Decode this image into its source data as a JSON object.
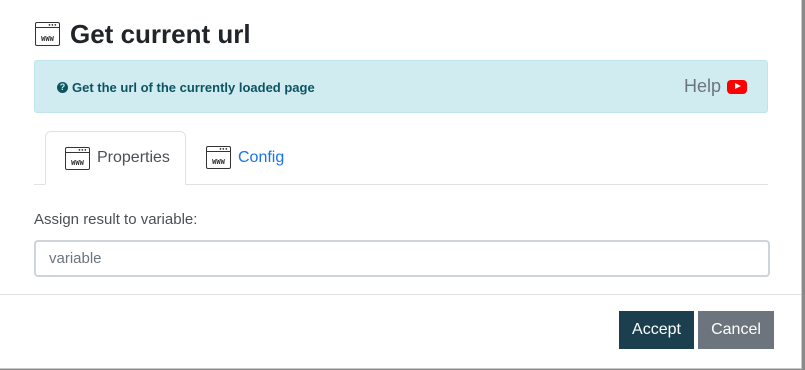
{
  "dialog": {
    "title": "Get current url",
    "title_icon": "www-icon"
  },
  "info": {
    "icon": "question-circle-icon",
    "text": "Get the url of the currently loaded page",
    "help_label": "Help",
    "help_icon": "youtube-icon"
  },
  "tabs": [
    {
      "label": "Properties",
      "icon": "www-icon",
      "active": true
    },
    {
      "label": "Config",
      "icon": "www-icon",
      "active": false
    }
  ],
  "form": {
    "variable_label": "Assign result to variable:",
    "variable_placeholder": "variable",
    "variable_value": ""
  },
  "footer": {
    "accept_label": "Accept",
    "cancel_label": "Cancel"
  },
  "icon_text": "WWW",
  "colors": {
    "accept": "#1c3f50",
    "cancel": "#6c757d",
    "info_bg": "#d1ecf1",
    "info_text": "#0c5460",
    "link": "#1a73e8"
  }
}
